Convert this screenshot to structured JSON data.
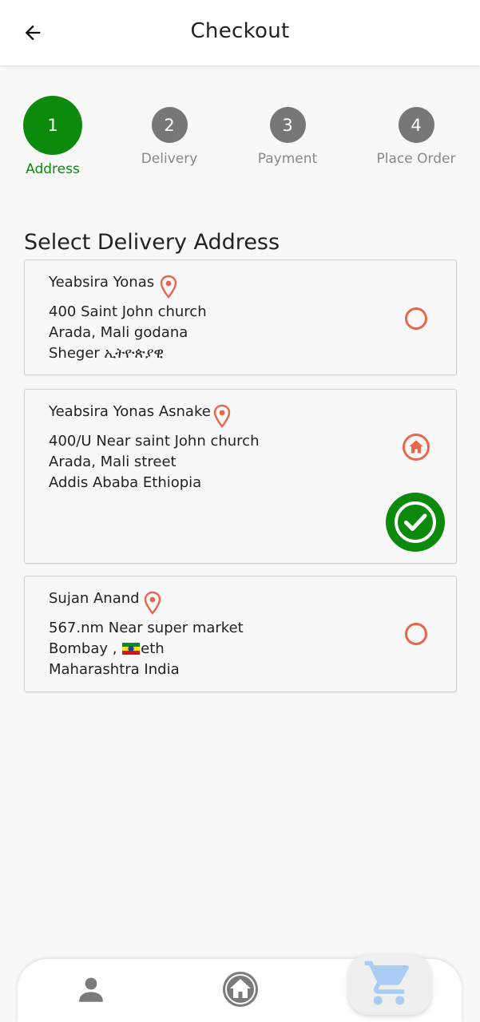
{
  "header": {
    "title": "Checkout"
  },
  "stepper": {
    "steps": [
      {
        "number": "1",
        "label": "Address"
      },
      {
        "number": "2",
        "label": "Delivery"
      },
      {
        "number": "3",
        "label": "Payment"
      },
      {
        "number": "4",
        "label": "Place Order"
      }
    ],
    "active_index": 0
  },
  "section_title": "Select Delivery Address",
  "addresses": [
    {
      "name": "Yeabsira Yonas",
      "line1": "400 Saint John church",
      "line2": "Arada, Mali godana",
      "line3": "Sheger ኢትዮጵያዊ",
      "selected": false,
      "is_home": false
    },
    {
      "name": "Yeabsira Yonas Asnake",
      "line1": "400/U Near saint John church",
      "line2": "Arada, Mali street",
      "line3": "Addis Ababa  Ethiopia",
      "selected": true,
      "is_home": true
    },
    {
      "name": "Sujan Anand",
      "line1": "567.nm Near super market",
      "line2_prefix": "Bombay , ",
      "line2_suffix": "eth",
      "line3": "Maharashtra  India",
      "selected": false,
      "is_home": false
    }
  ],
  "icons": {
    "back": "arrow-left-icon",
    "pin": "location-pin-icon",
    "home": "home-icon",
    "check": "check-circle-icon",
    "flag": "ethiopia-flag-icon",
    "nav_profile": "person-icon",
    "nav_home": "home-icon",
    "nav_cart": "cart-icon"
  },
  "colors": {
    "accent_green": "#0b8a0b",
    "accent_orange": "#e8664c",
    "inactive_step": "#777777",
    "cart_blue": "#a9cdf2"
  }
}
